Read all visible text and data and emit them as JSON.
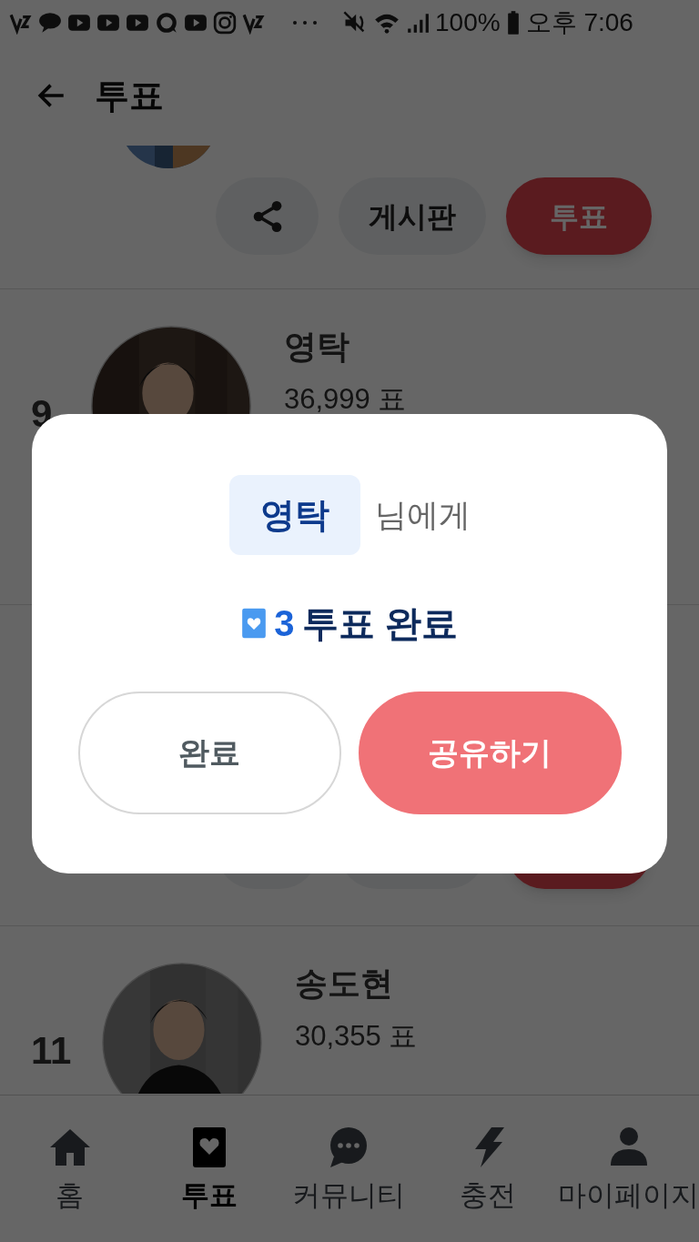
{
  "status_bar": {
    "time": "오후 7:06",
    "battery": "100%"
  },
  "header": {
    "title": "투표"
  },
  "list": [
    {
      "kind": "tail",
      "buttons": [
        {
          "kind": "share"
        },
        {
          "kind": "board",
          "label": "게시판"
        },
        {
          "kind": "vote",
          "label": "투표"
        }
      ]
    },
    {
      "kind": "candidate",
      "rank": "9",
      "name": "영탁",
      "votes": "36,999 표"
    },
    {
      "kind": "tail",
      "buttons": [
        {
          "kind": "share"
        },
        {
          "kind": "board"
        },
        {
          "kind": "vote"
        }
      ]
    },
    {
      "kind": "candidate",
      "rank": "11",
      "name": "송도현",
      "votes": "30,355 표"
    }
  ],
  "dialog": {
    "recipient": "영탁",
    "recipient_suffix": "님에게",
    "count": "3",
    "message": "투표 완료",
    "buttons": [
      {
        "kind": "secondary",
        "label": "완료"
      },
      {
        "kind": "primary",
        "label": "공유하기"
      }
    ]
  },
  "nav": [
    {
      "kind": "home",
      "label": "홈",
      "selected": false
    },
    {
      "kind": "vote",
      "label": "투표",
      "selected": true
    },
    {
      "kind": "community",
      "label": "커뮤니티",
      "selected": false
    },
    {
      "kind": "charge",
      "label": "충전",
      "selected": false
    },
    {
      "kind": "mypage",
      "label": "마이페이지",
      "selected": false
    }
  ]
}
